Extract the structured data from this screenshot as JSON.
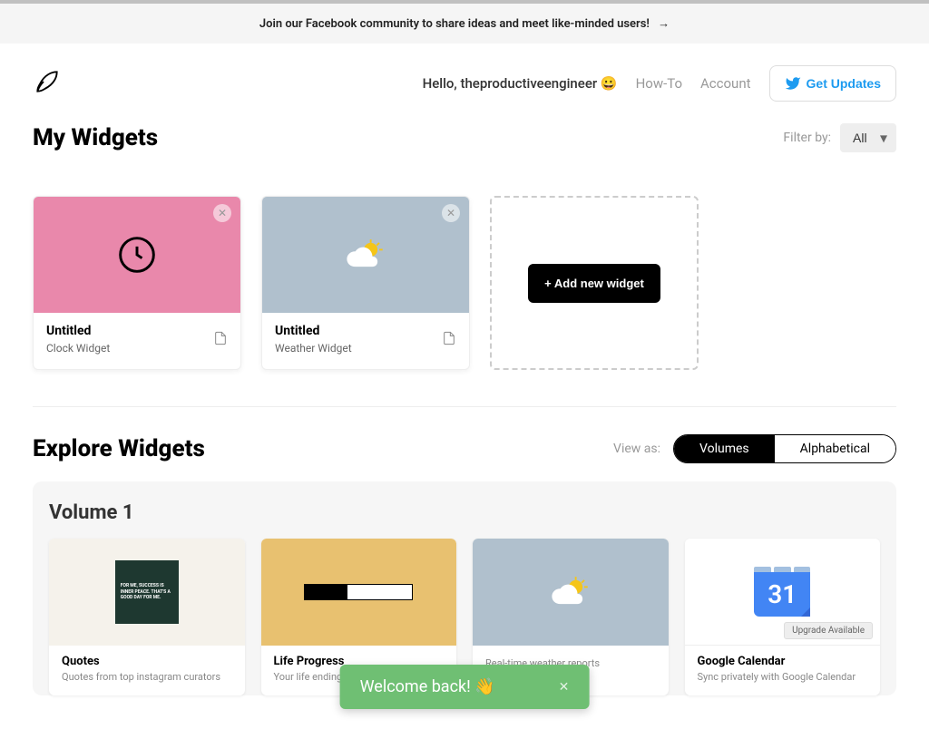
{
  "banner": {
    "text": "Join our Facebook community to share ideas and meet like-minded users!",
    "arrow": "→"
  },
  "header": {
    "greeting": "Hello, theproductiveengineer 😀",
    "nav": {
      "howto": "How-To",
      "account": "Account"
    },
    "updates_label": "Get Updates"
  },
  "myWidgets": {
    "title": "My Widgets",
    "filter_label": "Filter by:",
    "filter_value": "All",
    "widgets": [
      {
        "title": "Untitled",
        "subtitle": "Clock Widget"
      },
      {
        "title": "Untitled",
        "subtitle": "Weather Widget"
      }
    ],
    "add_label": "+ Add new widget"
  },
  "explore": {
    "title": "Explore Widgets",
    "view_label": "View as:",
    "view_options": {
      "volumes": "Volumes",
      "alpha": "Alphabetical"
    },
    "volume_title": "Volume 1",
    "cards": [
      {
        "title": "Quotes",
        "subtitle": "Quotes from top instagram curators"
      },
      {
        "title": "Life Progress",
        "subtitle": "Your life ending by the minute"
      },
      {
        "title": "",
        "subtitle": "Real-time weather reports"
      },
      {
        "title": "Google Calendar",
        "subtitle": "Sync privately with Google Calendar",
        "badge": "Upgrade Available"
      }
    ],
    "quote_text": "FOR ME, SUCCESS IS INNER PEACE. THAT'S A GOOD DAY FOR ME.",
    "calendar_day": "31"
  },
  "toast": {
    "text": "Welcome back! 👋",
    "close": "✕"
  }
}
